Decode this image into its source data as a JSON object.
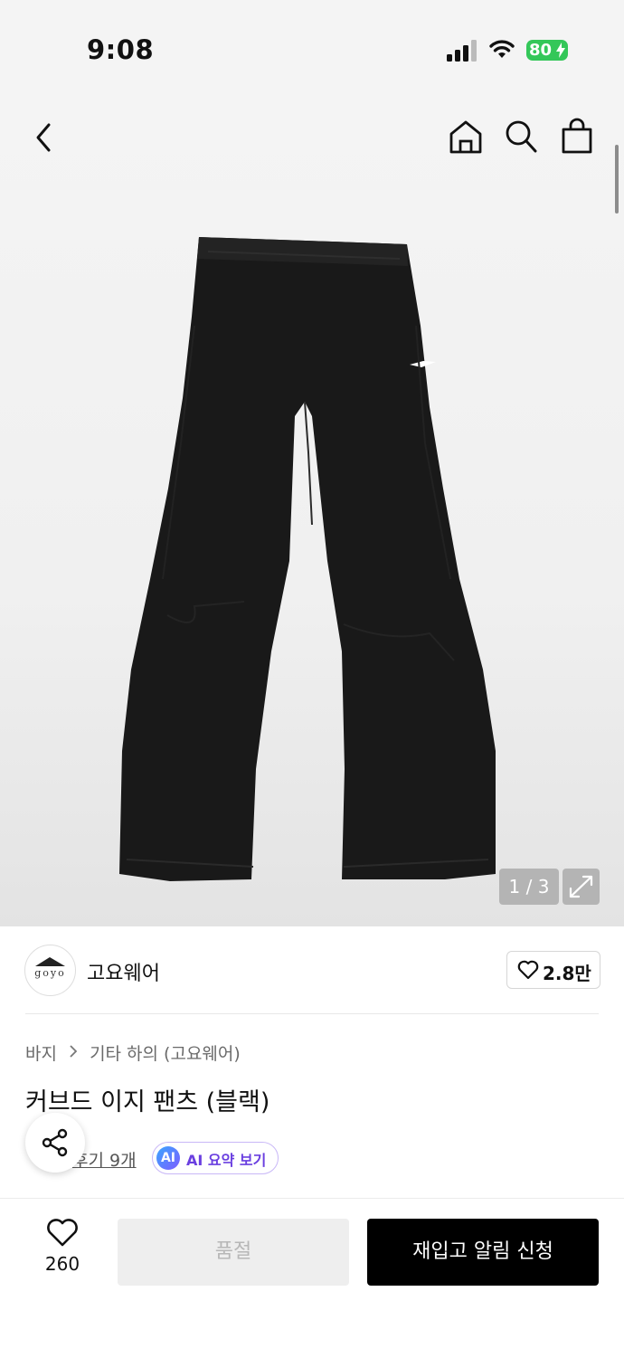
{
  "status_bar": {
    "time": "9:08",
    "battery": "80"
  },
  "gallery": {
    "counter": "1 / 3"
  },
  "brand": {
    "name": "고요웨어",
    "logo_text": "goyo",
    "likes": "2.8만"
  },
  "breadcrumb": {
    "category": "바지",
    "subcategory": "기타 하의 (고요웨어)"
  },
  "product": {
    "title": "커브드 이지 팬츠 (블랙)"
  },
  "reviews": {
    "link": "후기 9개"
  },
  "ai": {
    "badge": "AI",
    "label": "AI 요약 보기"
  },
  "bottom_bar": {
    "wish_count": "260",
    "soldout_label": "품절",
    "restock_label": "재입고 알림 신청"
  },
  "colors": {
    "accent": "#000000",
    "ai_purple": "#6a3fe0",
    "battery_green": "#34c759"
  }
}
